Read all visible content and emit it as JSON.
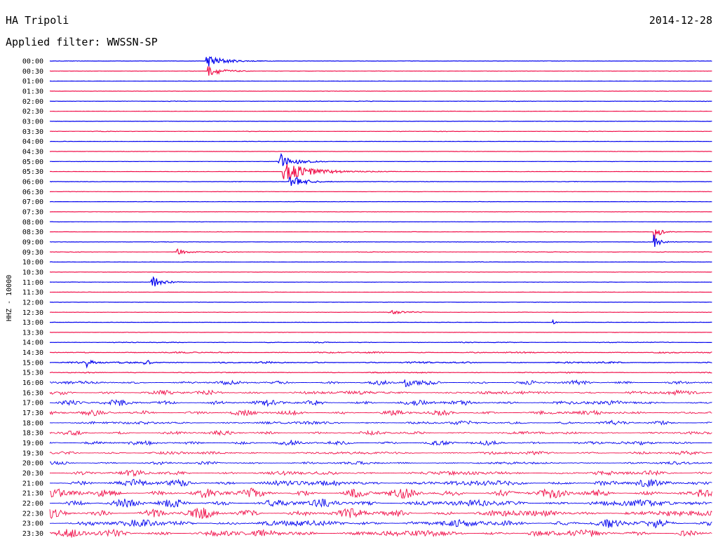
{
  "header": {
    "station": "HA Tripoli",
    "date": "2014-12-28",
    "filter": "Applied filter: WWSSN-SP"
  },
  "chart_data": {
    "type": "line",
    "channel_label": "HHZ - 10000",
    "row_labels": [
      "00:00",
      "00:30",
      "01:00",
      "01:30",
      "02:00",
      "02:30",
      "03:00",
      "03:30",
      "04:00",
      "04:30",
      "05:00",
      "05:30",
      "06:00",
      "06:30",
      "07:00",
      "07:30",
      "08:00",
      "08:30",
      "09:00",
      "09:30",
      "10:00",
      "10:30",
      "11:00",
      "11:30",
      "12:00",
      "12:30",
      "13:00",
      "13:30",
      "14:00",
      "14:30",
      "15:00",
      "15:30",
      "16:00",
      "16:30",
      "17:00",
      "17:30",
      "18:00",
      "18:30",
      "19:00",
      "19:30",
      "20:00",
      "20:30",
      "21:00",
      "21:30",
      "22:00",
      "22:30",
      "23:00",
      "23:30"
    ],
    "series_colors": [
      "#0000ee",
      "#f0104a"
    ],
    "trace_amplitude": [
      0.2,
      0.2,
      0.2,
      0.2,
      0.3,
      0.2,
      0.2,
      0.3,
      0.2,
      0.2,
      0.2,
      0.2,
      0.3,
      0.2,
      0.2,
      0.2,
      0.2,
      0.2,
      0.3,
      0.4,
      0.2,
      0.2,
      0.2,
      0.2,
      0.2,
      0.2,
      0.2,
      0.2,
      0.5,
      0.8,
      1.0,
      0.6,
      1.8,
      2.2,
      2.5,
      2.2,
      1.8,
      1.8,
      2.0,
      1.8,
      1.5,
      2.5,
      3.5,
      4.0,
      4.0,
      4.0,
      4.0,
      4.0
    ],
    "events": [
      {
        "row": 0,
        "x_minutes": 7.1,
        "amplitude": 9,
        "duration_minutes": 1.5
      },
      {
        "row": 1,
        "x_minutes": 7.2,
        "amplitude": 7,
        "duration_minutes": 1.2
      },
      {
        "row": 10,
        "x_minutes": 10.4,
        "amplitude": 12,
        "duration_minutes": 1.3
      },
      {
        "row": 11,
        "x_minutes": 10.6,
        "amplitude": 14,
        "duration_minutes": 2.5
      },
      {
        "row": 12,
        "x_minutes": 10.9,
        "amplitude": 10,
        "duration_minutes": 1.2
      },
      {
        "row": 17,
        "x_minutes": 27.4,
        "amplitude": 10,
        "duration_minutes": 0.5
      },
      {
        "row": 18,
        "x_minutes": 27.4,
        "amplitude": 9,
        "duration_minutes": 0.4
      },
      {
        "row": 19,
        "x_minutes": 5.8,
        "amplitude": 4,
        "duration_minutes": 0.8
      },
      {
        "row": 22,
        "x_minutes": 4.6,
        "amplitude": 9,
        "duration_minutes": 0.9
      },
      {
        "row": 25,
        "x_minutes": 15.4,
        "amplitude": 3,
        "duration_minutes": 1.6
      },
      {
        "row": 26,
        "x_minutes": 22.8,
        "amplitude": 3,
        "duration_minutes": 0.2
      },
      {
        "row": 30,
        "x_minutes": 1.7,
        "amplitude": 5,
        "duration_minutes": 0.4
      },
      {
        "row": 30,
        "x_minutes": 4.3,
        "amplitude": 6,
        "duration_minutes": 0.4
      },
      {
        "row": 32,
        "x_minutes": 16.1,
        "amplitude": 8,
        "duration_minutes": 0.6
      }
    ]
  }
}
